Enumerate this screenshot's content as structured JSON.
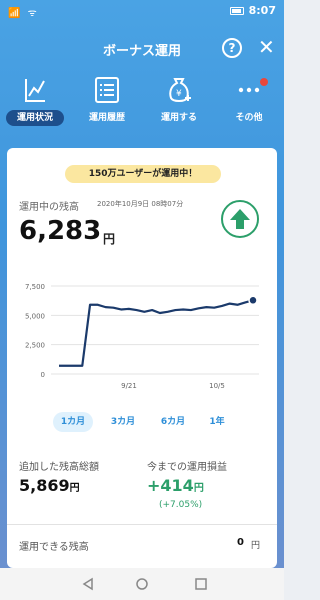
{
  "status_bar": {
    "left_icons": "📶 ᯤ",
    "time": "8:07"
  },
  "header": {
    "title": "ボーナス運用",
    "help_label": "?",
    "close_label": "✕"
  },
  "nav": {
    "items": [
      {
        "label": "運用状況",
        "icon": "chart-line-icon",
        "active": true
      },
      {
        "label": "運用履歴",
        "icon": "list-icon",
        "active": false
      },
      {
        "label": "運用する",
        "icon": "money-bag-plus-icon",
        "active": false
      },
      {
        "label": "その他",
        "icon": "more-dots-icon",
        "active": false
      }
    ]
  },
  "card": {
    "banner": "150万ユーザーが運用中！",
    "balance_label": "運用中の残高",
    "balance_date": "2020年10月9日 08時07分",
    "balance_value": "6,283",
    "balance_unit": "円",
    "periods": [
      "1カ月",
      "3カ月",
      "6カ月",
      "1年"
    ],
    "added_label": "追加した残高総額",
    "added_value": "5,869",
    "added_unit": "円",
    "pl_label": "今までの運用損益",
    "pl_value": "+414",
    "pl_unit": "円",
    "pl_percent": "(+7.05%)",
    "available_label": "運用できる残高",
    "available_value": "0",
    "available_unit": "円"
  },
  "colors": {
    "accent": "#2f8fd8",
    "positive": "#2c9f6a",
    "line": "#1b3a6b",
    "banner": "#fbe7a0"
  },
  "chart_data": {
    "type": "line",
    "x_ticks": [
      "9/21",
      "10/5"
    ],
    "y_ticks": [
      "0",
      "2,500",
      "5,000",
      "7,500"
    ],
    "ylim": [
      0,
      7500
    ],
    "grid": true,
    "series": [
      {
        "values": [
          700,
          700,
          700,
          700,
          5900,
          5900,
          5700,
          5650,
          5500,
          5550,
          5450,
          5300,
          5450,
          5200,
          5300,
          5450,
          5500,
          5450,
          5600,
          5700,
          5650,
          5800,
          6000,
          5900,
          6100,
          6283
        ]
      }
    ]
  }
}
